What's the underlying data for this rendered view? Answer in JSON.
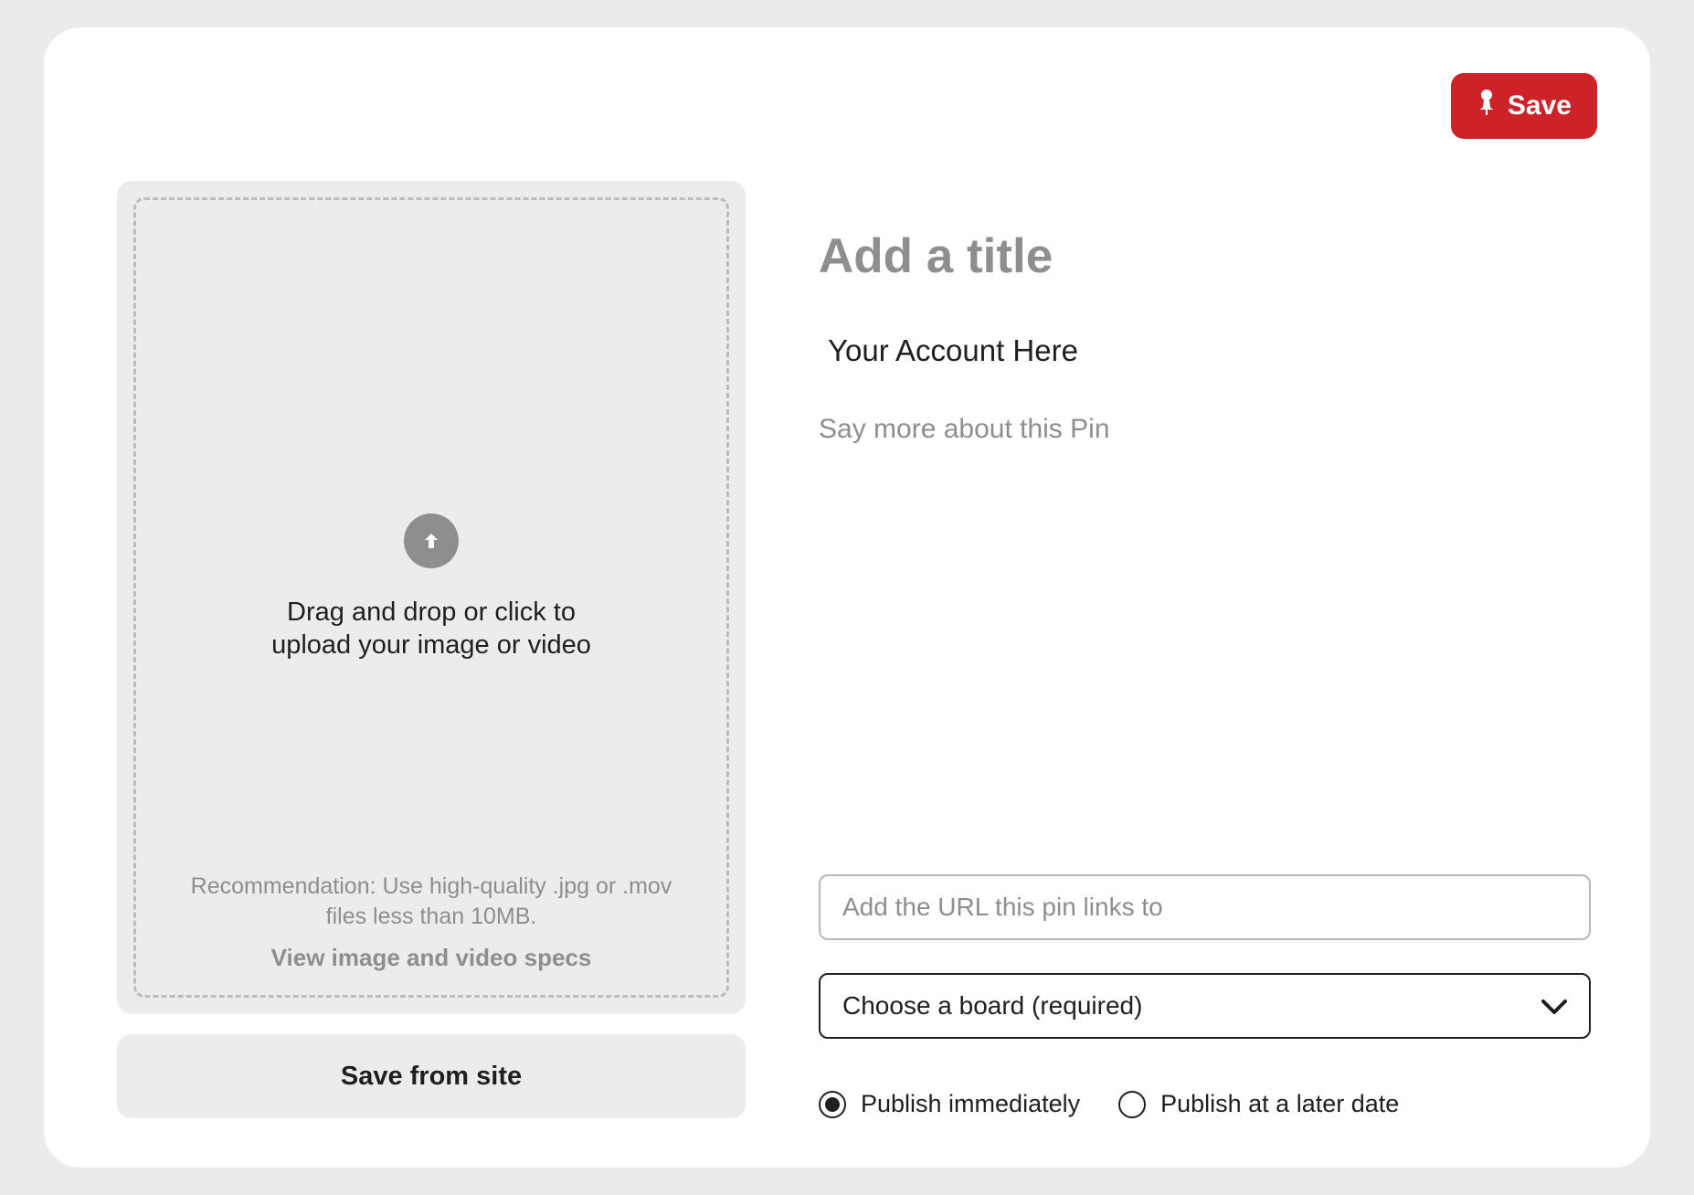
{
  "header": {
    "save_label": "Save"
  },
  "upload": {
    "drag_text": "Drag and drop or click to upload your image or video",
    "recommendation": "Recommendation: Use high-quality .jpg or .mov files less than 10MB.",
    "specs_link": "View image and video specs",
    "save_from_site": "Save from site"
  },
  "form": {
    "title_placeholder": "Add a title",
    "account_label": "Your Account Here",
    "description_placeholder": "Say more about this Pin",
    "url_placeholder": "Add the URL this pin links to",
    "board_placeholder": "Choose a board (required)"
  },
  "publish": {
    "immediate_label": "Publish immediately",
    "later_label": "Publish at a later date",
    "selected": "immediate"
  }
}
